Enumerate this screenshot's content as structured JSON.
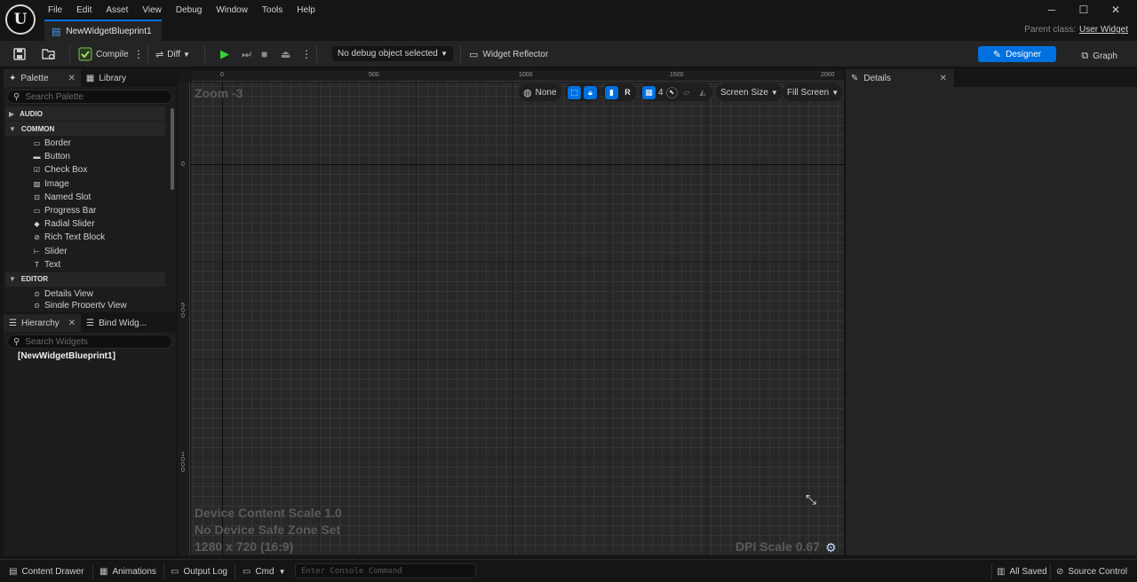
{
  "app": {
    "logo": "U"
  },
  "menu": [
    "File",
    "Edit",
    "Asset",
    "View",
    "Debug",
    "Window",
    "Tools",
    "Help"
  ],
  "document_tab": {
    "label": "NewWidgetBlueprint1",
    "icon": "widget-blueprint-icon"
  },
  "window_controls": {
    "minimize": "─",
    "maximize": "☐",
    "close": "✕"
  },
  "parent_class": {
    "label": "Parent class:",
    "value": "User Widget"
  },
  "toolbar": {
    "compile_label": "Compile",
    "diff_label": "Diff",
    "debug_select_value": "No debug object selected",
    "widget_reflector_label": "Widget Reflector",
    "designer_label": "Designer",
    "graph_label": "Graph"
  },
  "palette": {
    "tab_palette": "Palette",
    "tab_library": "Library",
    "search_placeholder": "Search Palette",
    "categories": {
      "audio": "AUDIO",
      "common": "COMMON",
      "editor": "EDITOR"
    },
    "common_items": [
      {
        "label": "Border",
        "icon": "border-icon"
      },
      {
        "label": "Button",
        "icon": "button-icon"
      },
      {
        "label": "Check Box",
        "icon": "checkbox-icon"
      },
      {
        "label": "Image",
        "icon": "image-icon"
      },
      {
        "label": "Named Slot",
        "icon": "named-slot-icon"
      },
      {
        "label": "Progress Bar",
        "icon": "progress-bar-icon"
      },
      {
        "label": "Radial Slider",
        "icon": "radial-slider-icon"
      },
      {
        "label": "Rich Text Block",
        "icon": "rich-text-icon"
      },
      {
        "label": "Slider",
        "icon": "slider-icon"
      },
      {
        "label": "Text",
        "icon": "text-icon"
      }
    ],
    "editor_items": [
      {
        "label": "Details View",
        "icon": "details-view-icon"
      },
      {
        "label": "Single Property View",
        "icon": "property-view-icon"
      }
    ]
  },
  "hierarchy": {
    "tab_hierarchy": "Hierarchy",
    "tab_bind": "Bind Widg...",
    "search_placeholder": "Search Widgets",
    "root": "[NewWidgetBlueprint1]"
  },
  "canvas": {
    "zoom": "Zoom -3",
    "ruler_top": [
      "0",
      "500",
      "1000",
      "1500",
      "2000"
    ],
    "ruler_left": [
      "0",
      "500",
      "1000"
    ],
    "toolbar": {
      "locale": "None",
      "respect_label": "R",
      "grid_snap": "4",
      "screen_size": "Screen Size",
      "fill_screen": "Fill Screen"
    },
    "overlay": {
      "content_scale": "Device Content Scale 1.0",
      "safe_zone": "No Device Safe Zone Set",
      "resolution": "1280 x 720 (16:9)",
      "dpi_scale": "DPI Scale 0.67"
    }
  },
  "details": {
    "tab_label": "Details"
  },
  "statusbar": {
    "content_drawer": "Content Drawer",
    "animations": "Animations",
    "output_log": "Output Log",
    "cmd": "Cmd",
    "console_placeholder": "Enter Console Command",
    "all_saved": "All Saved",
    "source_control": "Source Control"
  },
  "colors": {
    "accent": "#0070e0",
    "play": "#3ad13a",
    "background": "#151515",
    "panel": "#242424"
  }
}
